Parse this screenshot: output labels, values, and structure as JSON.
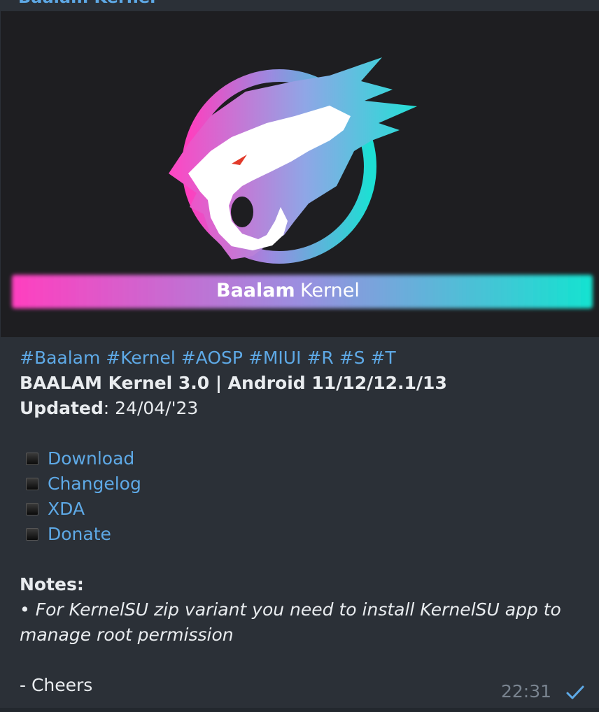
{
  "message": {
    "sender": "Baalam Kernel",
    "media": {
      "banner_bold": "Baalam",
      "banner_light": "Kernel",
      "colors": {
        "pink": "#ff3fbf",
        "cyan": "#1ddfd4",
        "background": "#1e1e21"
      }
    },
    "hashtags": "#Baalam #Kernel #AOSP #MIUI #R #S #T",
    "title": "BAALAM Kernel 3.0 | Android 11/12/12.1/13",
    "updated_label": "Updated",
    "updated_value": ": 24/04/'23",
    "links": [
      {
        "label": "Download"
      },
      {
        "label": "Changelog"
      },
      {
        "label": "XDA"
      },
      {
        "label": "Donate"
      }
    ],
    "notes_label": "Notes:",
    "notes_text": "• For KernelSU zip variant you need to install KernelSU app to manage root permission",
    "signoff": "- Cheers",
    "time": "22:31",
    "status_icon": "check-icon",
    "colors": {
      "link": "#5ea9e6",
      "text": "#e9ecef",
      "bubble": "#2b3037"
    }
  }
}
